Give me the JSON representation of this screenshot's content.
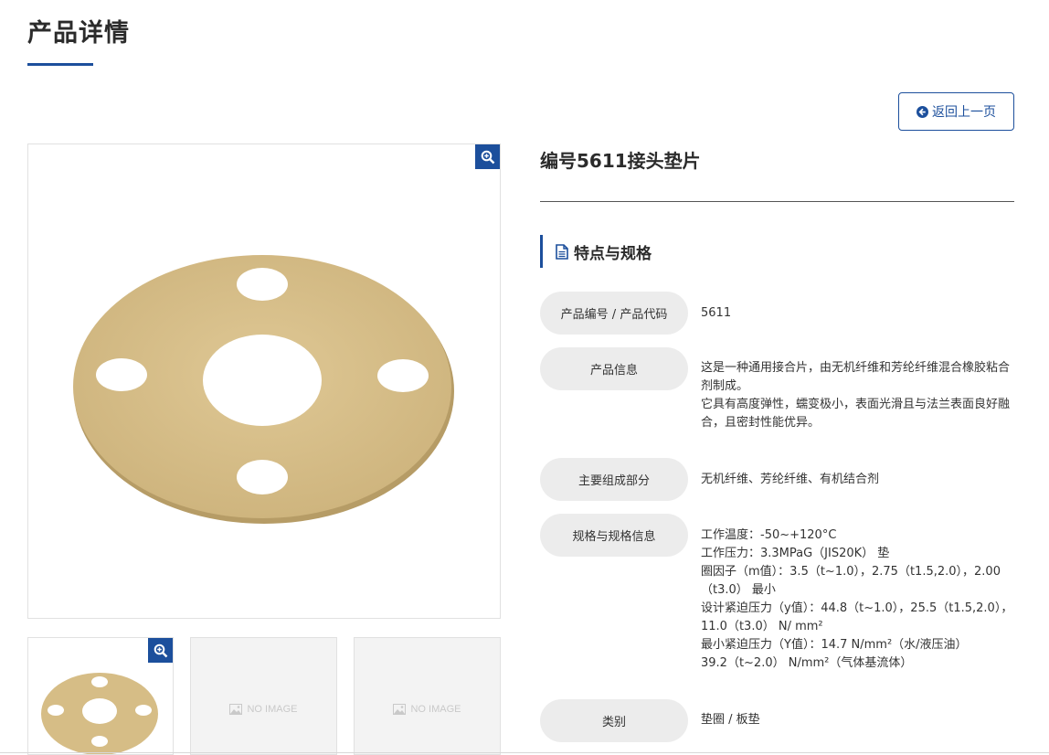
{
  "page": {
    "title": "产品详情"
  },
  "back_button": {
    "label": "返回上一页",
    "icon": "arrow-circle-left-icon"
  },
  "product": {
    "name": "编号5611接头垫片"
  },
  "gallery": {
    "zoom_icon": "zoom-in-icon",
    "placeholder_text": "NO IMAGE"
  },
  "specs": {
    "section_title": "特点与规格",
    "rows": [
      {
        "label": "产品编号 / 产品代码",
        "lines": [
          "5611"
        ]
      },
      {
        "label": "产品信息",
        "lines": [
          "这是一种通用接合片，由无机纤维和芳纶纤维混合橡胶粘合剂制成。",
          "它具有高度弹性，蠕变极小，表面光滑且与法兰表面良好融合，且密封性能优异。"
        ]
      },
      {
        "label": "主要组成部分",
        "lines": [
          "无机纤维、芳纶纤维、有机结合剂"
        ]
      },
      {
        "label": "规格与规格信息",
        "lines": [
          "工作温度：-50~+120°C",
          "工作压力：3.3MPaG（JIS20K） 垫",
          "圈因子（m值）：3.5（t~1.0），2.75（t1.5,2.0），2.00（t3.0） 最小",
          "设计紧迫压力（y值）：44.8（t~1.0），25.5（t1.5,2.0），11.0（t3.0） N/ mm²",
          "最小紧迫压力（Y值）：14.7 N/mm²（水/液压油）",
          "39.2（t~2.0） N/mm²（气体基流体）"
        ]
      },
      {
        "label": "类别",
        "lines": [
          "垫圈 / 板垫"
        ]
      }
    ]
  },
  "colors": {
    "accent": "#1c4f9c",
    "label_bg": "#ececec",
    "gasket": "#d8c08c"
  }
}
